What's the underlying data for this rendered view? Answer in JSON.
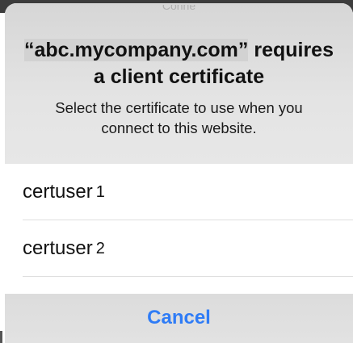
{
  "dialog": {
    "clipped_text": "Conne",
    "title_host": "“abc.mycompany.com”",
    "title_rest_line1": " requires",
    "title_line2": "a client certificate",
    "message_line1": "Select the certificate to use when you",
    "message_line2": "connect to this website."
  },
  "certificates": [
    {
      "name": "certuser",
      "number": "1"
    },
    {
      "name": "certuser",
      "number": "2"
    }
  ],
  "actions": {
    "cancel_label": "Cancel"
  },
  "colors": {
    "accent": "#2f7cf6",
    "header_bg": "#e4e4e4"
  }
}
